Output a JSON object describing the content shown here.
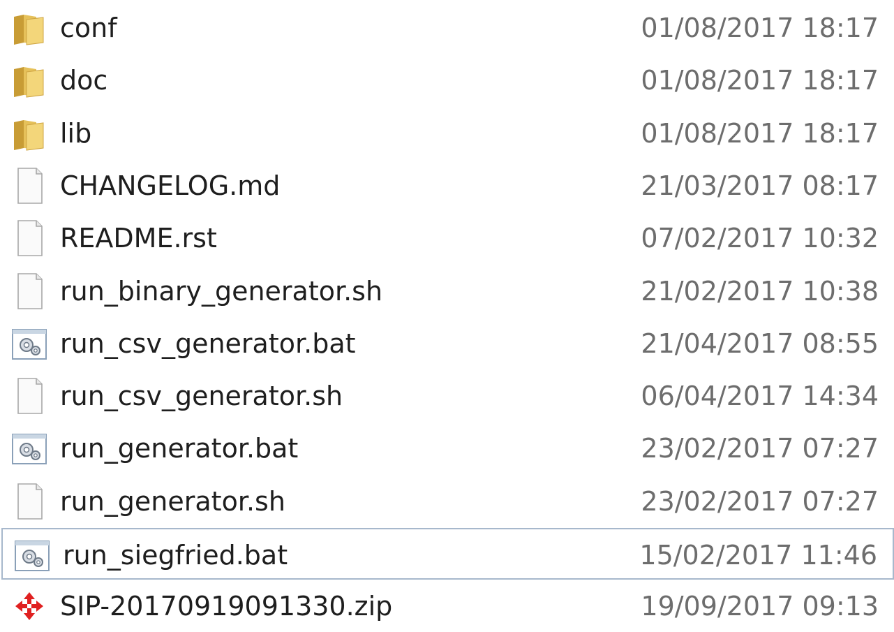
{
  "files": [
    {
      "name": "conf",
      "date": "01/08/2017 18:17",
      "icon": "folder-icon"
    },
    {
      "name": "doc",
      "date": "01/08/2017 18:17",
      "icon": "folder-icon"
    },
    {
      "name": "lib",
      "date": "01/08/2017 18:17",
      "icon": "folder-icon"
    },
    {
      "name": "CHANGELOG.md",
      "date": "21/03/2017 08:17",
      "icon": "document-icon"
    },
    {
      "name": "README.rst",
      "date": "07/02/2017 10:32",
      "icon": "document-icon"
    },
    {
      "name": "run_binary_generator.sh",
      "date": "21/02/2017 10:38",
      "icon": "document-icon"
    },
    {
      "name": "run_csv_generator.bat",
      "date": "21/04/2017 08:55",
      "icon": "batch-file-icon"
    },
    {
      "name": "run_csv_generator.sh",
      "date": "06/04/2017 14:34",
      "icon": "document-icon"
    },
    {
      "name": "run_generator.bat",
      "date": "23/02/2017 07:27",
      "icon": "batch-file-icon"
    },
    {
      "name": "run_generator.sh",
      "date": "23/02/2017 07:27",
      "icon": "document-icon"
    },
    {
      "name": "run_siegfried.bat",
      "date": "15/02/2017 11:46",
      "icon": "batch-file-icon"
    },
    {
      "name": "SIP-20170919091330.zip",
      "date": "19/09/2017 09:13",
      "icon": "zip-archive-icon"
    }
  ],
  "focused_file": "run_siegfried.bat",
  "colors": {
    "folder": "#e6c15a",
    "text": "#1e1e1e",
    "date": "#6d6d6d",
    "focus_border": "#a7b8cc",
    "zip_icon": "#e02020"
  }
}
